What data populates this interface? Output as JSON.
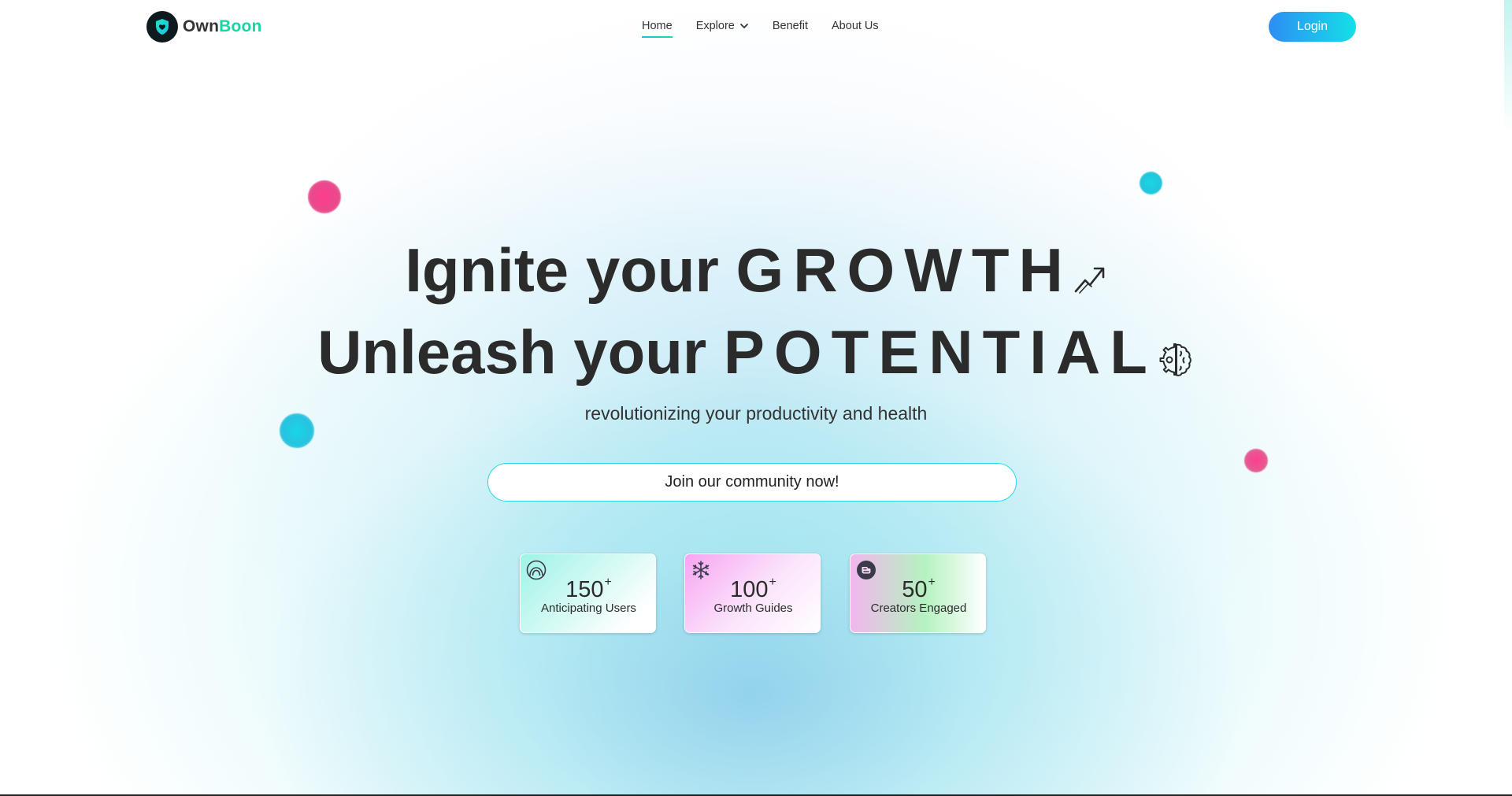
{
  "brand": {
    "name_part1": "Own",
    "name_part2": "Boon",
    "accent_color": "#16d6a3"
  },
  "nav": {
    "items": [
      {
        "label": "Home",
        "active": true
      },
      {
        "label": "Explore",
        "has_dropdown": true
      },
      {
        "label": "Benefit"
      },
      {
        "label": "About Us"
      }
    ],
    "login_label": "Login"
  },
  "hero": {
    "line1_prefix": "Ignite your",
    "line1_emphasis": "GROWTH",
    "line1_icon": "trending-up-icon",
    "line2_prefix": "Unleash your",
    "line2_emphasis": "POTENTIAL",
    "line2_icon": "brain-gear-icon",
    "subtitle": "revolutionizing your productivity and health",
    "cta_label": "Join our community now!"
  },
  "stats": [
    {
      "value": "150",
      "suffix": "+",
      "label": "Anticipating Users",
      "icon": "rainbow-circle-icon"
    },
    {
      "value": "100",
      "suffix": "+",
      "label": "Growth Guides",
      "icon": "snowflake-icon"
    },
    {
      "value": "50",
      "suffix": "+",
      "label": "Creators Engaged",
      "icon": "blogger-icon"
    }
  ],
  "colors": {
    "login_gradient_start": "#2d8df5",
    "login_gradient_end": "#13e0e6",
    "orb_pink": "#ff3d8e",
    "orb_cyan": "#19d6e6"
  }
}
